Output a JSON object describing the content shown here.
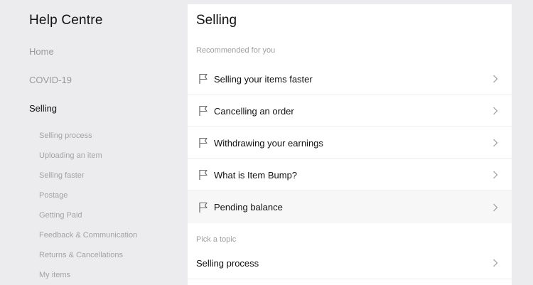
{
  "sidebar": {
    "title": "Help Centre",
    "nav": [
      {
        "label": "Home"
      },
      {
        "label": "COVID-19"
      },
      {
        "label": "Selling"
      }
    ],
    "sub_items": [
      {
        "label": "Selling process"
      },
      {
        "label": "Uploading an item"
      },
      {
        "label": "Selling faster"
      },
      {
        "label": "Postage"
      },
      {
        "label": "Getting Paid"
      },
      {
        "label": "Feedback & Communication"
      },
      {
        "label": "Returns & Cancellations"
      },
      {
        "label": "My items"
      }
    ]
  },
  "main": {
    "title": "Selling",
    "recommended_label": "Recommended for you",
    "recommended": [
      {
        "label": "Selling your items faster",
        "icon": "flag-icon"
      },
      {
        "label": "Cancelling an order",
        "icon": "flag-icon"
      },
      {
        "label": "Withdrawing your earnings",
        "icon": "flag-icon"
      },
      {
        "label": "What is Item Bump?",
        "icon": "flag-icon"
      },
      {
        "label": "Pending balance",
        "icon": "flag-icon"
      }
    ],
    "topic_label": "Pick a topic",
    "topics": [
      {
        "label": "Selling process"
      }
    ]
  },
  "colors": {
    "background": "#ececee",
    "panel": "#ffffff",
    "muted_text": "#999999",
    "primary_text": "#111111"
  }
}
